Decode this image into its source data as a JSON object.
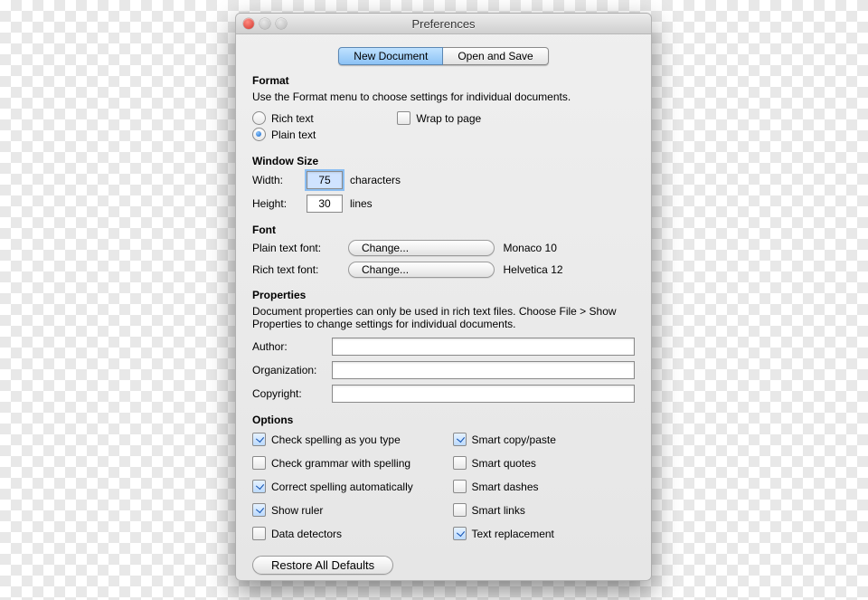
{
  "window": {
    "title": "Preferences"
  },
  "tabs": {
    "new_doc": "New Document",
    "open_save": "Open and Save"
  },
  "format": {
    "heading": "Format",
    "help": "Use the Format menu to choose settings for individual documents.",
    "rich_text": "Rich text",
    "plain_text": "Plain text",
    "wrap": "Wrap to page",
    "selected": "plain_text",
    "wrap_checked": false
  },
  "window_size": {
    "heading": "Window Size",
    "width_label": "Width:",
    "width_value": "75",
    "width_unit": "characters",
    "height_label": "Height:",
    "height_value": "30",
    "height_unit": "lines"
  },
  "font": {
    "heading": "Font",
    "plain_label": "Plain text font:",
    "rich_label": "Rich text font:",
    "change": "Change...",
    "plain_value": "Monaco 10",
    "rich_value": "Helvetica 12"
  },
  "properties": {
    "heading": "Properties",
    "help": "Document properties can only be used in rich text files. Choose File > Show Properties to change settings for individual documents.",
    "author_label": "Author:",
    "org_label": "Organization:",
    "copyright_label": "Copyright:",
    "author": "",
    "organization": "",
    "copyright": ""
  },
  "options": {
    "heading": "Options",
    "left": [
      {
        "label": "Check spelling as you type",
        "checked": true
      },
      {
        "label": "Check grammar with spelling",
        "checked": false
      },
      {
        "label": "Correct spelling automatically",
        "checked": true
      },
      {
        "label": "Show ruler",
        "checked": true
      },
      {
        "label": "Data detectors",
        "checked": false
      }
    ],
    "right": [
      {
        "label": "Smart copy/paste",
        "checked": true
      },
      {
        "label": "Smart quotes",
        "checked": false
      },
      {
        "label": "Smart dashes",
        "checked": false
      },
      {
        "label": "Smart links",
        "checked": false
      },
      {
        "label": "Text replacement",
        "checked": true
      }
    ]
  },
  "footer": {
    "restore": "Restore All Defaults"
  }
}
